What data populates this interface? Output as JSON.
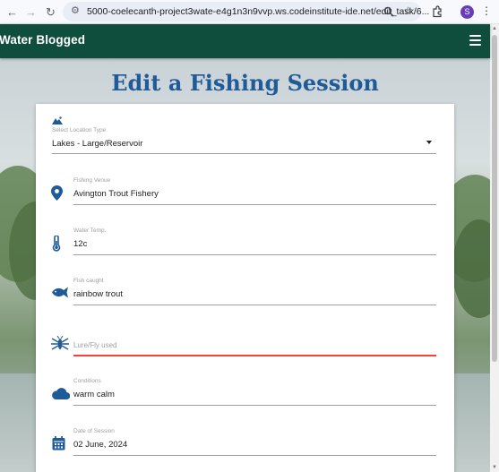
{
  "browser": {
    "url": "5000-coelecanth-project3wate-e4g1n3n9vvp.ws.codeinstitute-ide.net/edit_task/6...",
    "profile_initial": "S"
  },
  "navbar": {
    "brand": "Water Blogged"
  },
  "page": {
    "title": "Edit a Fishing Session"
  },
  "form": {
    "location_type": {
      "label": "Select Location Type",
      "value": "Lakes - Large/Reservoir"
    },
    "venue": {
      "label": "Fishing Venue",
      "value": "Avington Trout Fishery"
    },
    "water_temp": {
      "label": "Water Temp.",
      "value": "12c"
    },
    "fish_caught": {
      "label": "Fish caught",
      "value": "rainbow trout"
    },
    "lure": {
      "placeholder": "Lure/Fly used",
      "value": ""
    },
    "conditions": {
      "label": "Conditions",
      "value": "warm calm"
    },
    "date": {
      "label": "Date of Session",
      "value": "02 June, 2024"
    }
  },
  "colors": {
    "navbar": "#0f4d3c",
    "accent": "#1f5a99",
    "invalid": "#f44336"
  }
}
